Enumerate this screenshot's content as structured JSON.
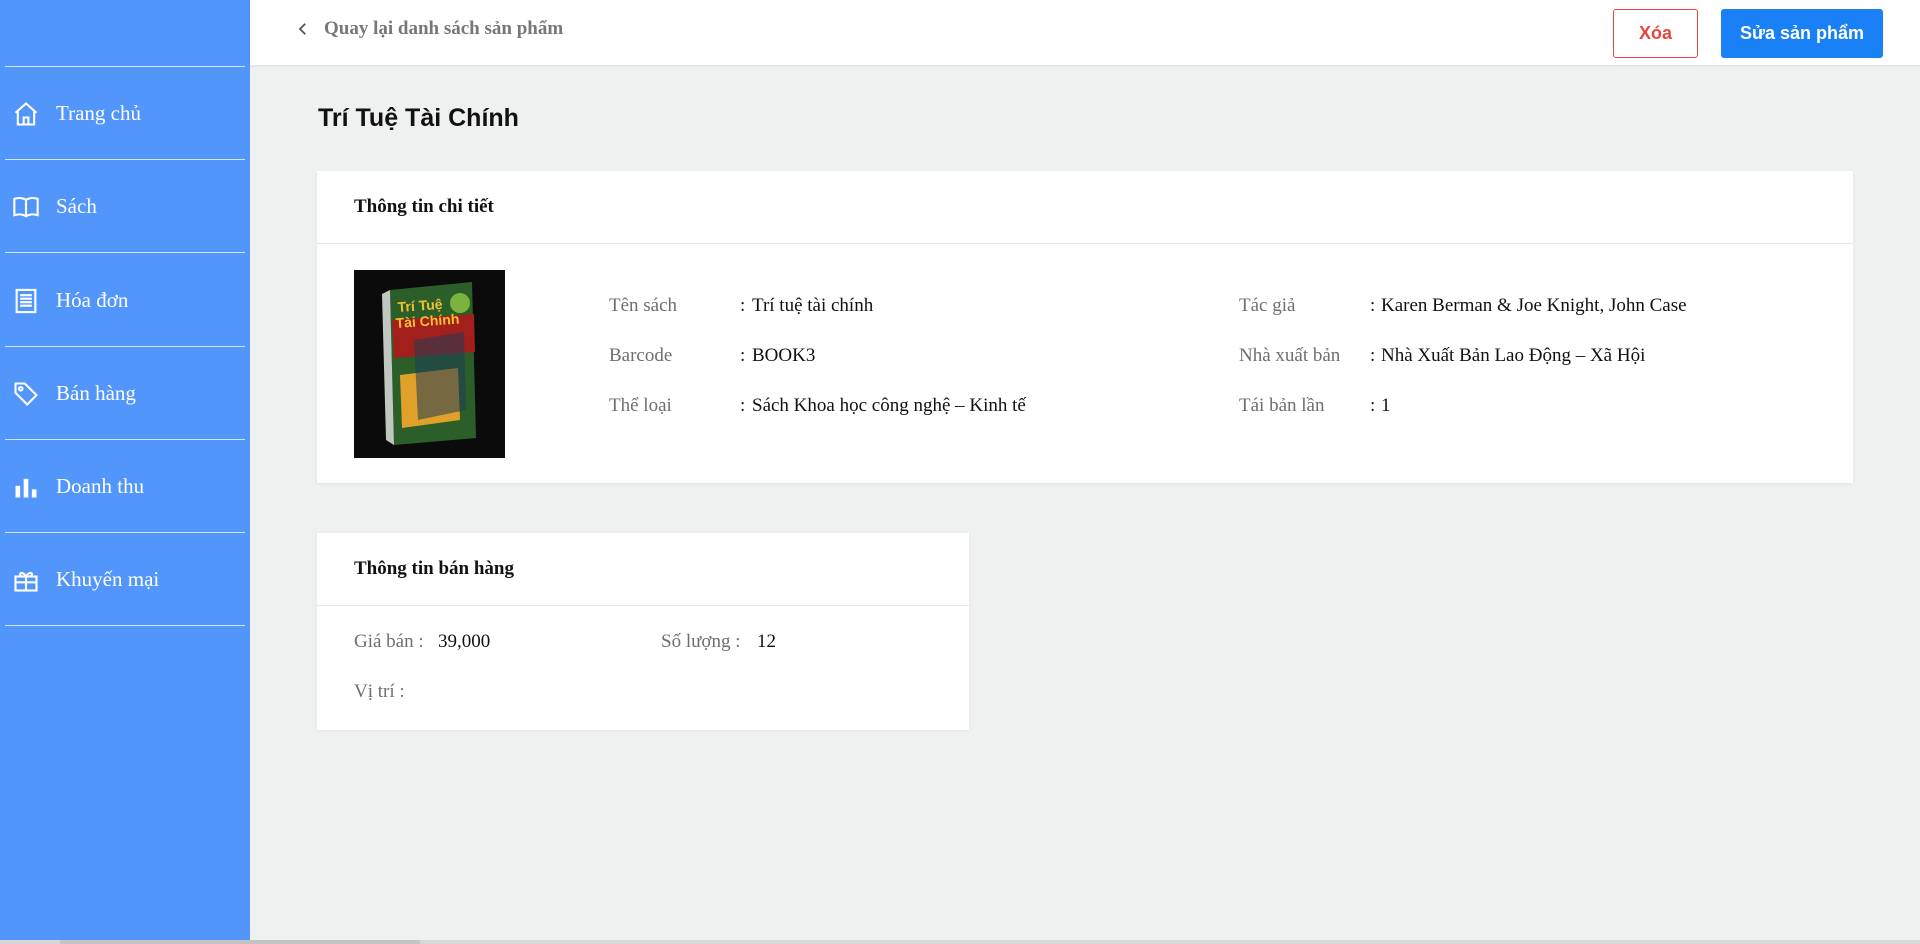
{
  "sidebar": {
    "items": [
      {
        "label": "Trang chủ",
        "icon": "home-icon"
      },
      {
        "label": "Sách",
        "icon": "book-icon"
      },
      {
        "label": "Hóa đơn",
        "icon": "receipt-icon"
      },
      {
        "label": "Bán hàng",
        "icon": "tag-icon"
      },
      {
        "label": "Doanh thu",
        "icon": "bar-chart-icon"
      },
      {
        "label": "Khuyến mại",
        "icon": "gift-icon"
      }
    ]
  },
  "topbar": {
    "back_label": "Quay lại danh sách sản phẩm",
    "delete_label": "Xóa",
    "edit_label": "Sửa sản phẩm"
  },
  "page": {
    "title": "Trí Tuệ Tài Chính"
  },
  "detail": {
    "heading": "Thông tin chi tiết",
    "fields": {
      "name": {
        "label": "Tên sách",
        "value": "Trí tuệ tài chính"
      },
      "barcode": {
        "label": "Barcode",
        "value": "BOOK3"
      },
      "category": {
        "label": "Thể loại",
        "value": "Sách Khoa học công nghệ – Kinh tế"
      },
      "author": {
        "label": "Tác giả",
        "value": "Karen Berman & Joe Knight, John Case"
      },
      "publisher": {
        "label": "Nhà xuất bản",
        "value": "Nhà Xuất Bản Lao Động – Xã Hội"
      },
      "edition": {
        "label": "Tái bản lần",
        "value": "1"
      }
    },
    "colon": ":"
  },
  "sales": {
    "heading": "Thông tin bán hàng",
    "price": {
      "label": "Giá bán :",
      "value": "39,000"
    },
    "quantity": {
      "label": "Số lượng :",
      "value": "12"
    },
    "location": {
      "label": "Vị trí :",
      "value": ""
    }
  },
  "colors": {
    "sidebar": "#5296fb",
    "primary": "#1a80f5",
    "danger": "#e8453c",
    "background": "#eff0f0"
  }
}
